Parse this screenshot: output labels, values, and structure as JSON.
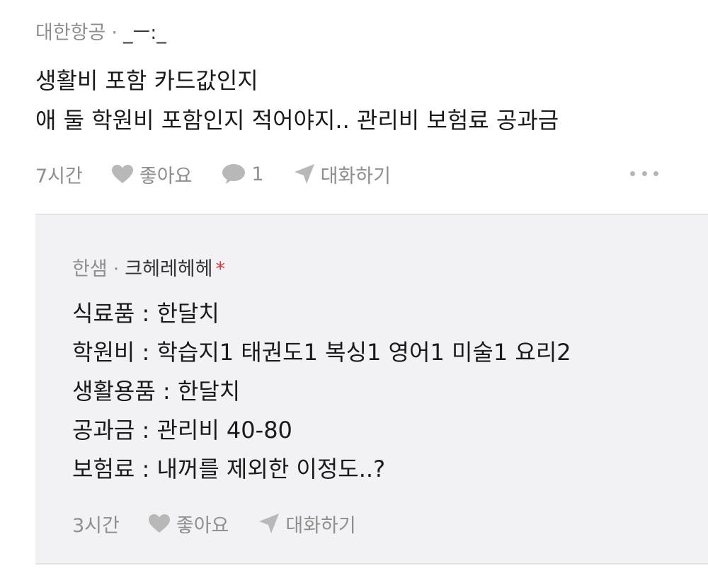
{
  "comment": {
    "source": "대한항공",
    "separator": "·",
    "nickname": "_ㅡ:_",
    "lines": [
      "생활비 포함 카드값인지",
      "애 둘 학원비 포함인지 적어야지.. 관리비 보험료 공과금"
    ],
    "time": "7시간",
    "like_label": "좋아요",
    "reply_count": "1",
    "chat_label": "대화하기",
    "icons": [
      "heart-icon",
      "comment-bubble-icon",
      "send-icon",
      "more-icon"
    ]
  },
  "reply": {
    "source": "한샘",
    "separator": "·",
    "nickname": "크헤레헤헤",
    "author_mark": "*",
    "lines": [
      "식료품 : 한달치",
      "학원비 : 학습지1 태권도1 복싱1 영어1 미술1 요리2",
      "생활용품 : 한달치",
      "공과금 : 관리비 40-80",
      "보험료 : 내꺼를 제외한 이정도..?"
    ],
    "time": "3시간",
    "like_label": "좋아요",
    "chat_label": "대화하기"
  },
  "colors": {
    "muted_text": "#8e8e8e",
    "reply_background": "#f2f2f4",
    "author_mark": "#e0333a",
    "icon_gray": "#b8b8b8"
  }
}
